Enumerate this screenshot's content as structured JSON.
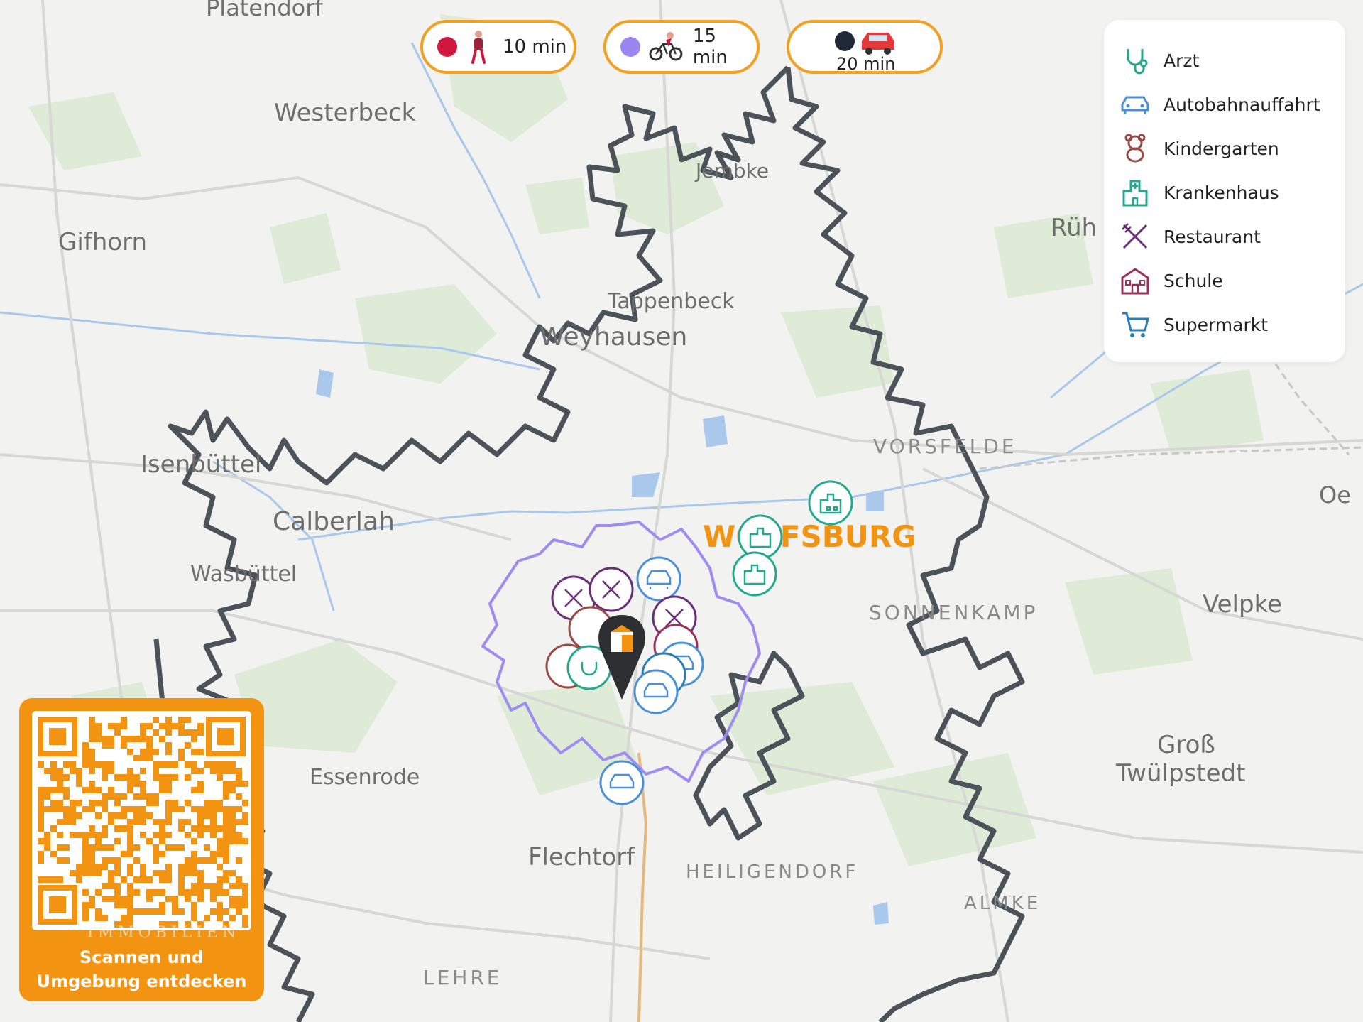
{
  "map": {
    "places": [
      {
        "id": "platendorf",
        "label": "Platendorf"
      },
      {
        "id": "westerbeck",
        "label": "Westerbeck"
      },
      {
        "id": "gifhorn",
        "label": "Gifhorn"
      },
      {
        "id": "jembke",
        "label": "Jembke"
      },
      {
        "id": "ruehen",
        "label": "Rüh"
      },
      {
        "id": "tappenbeck",
        "label": "Tappenbeck"
      },
      {
        "id": "weyhausen",
        "label": "Weyhausen"
      },
      {
        "id": "isenbuettel",
        "label": "Isenbüttel"
      },
      {
        "id": "calberlah",
        "label": "Calberlah"
      },
      {
        "id": "wasbuettel",
        "label": "Wasbüttel"
      },
      {
        "id": "vorsfelde",
        "label": "VORSFELDE"
      },
      {
        "id": "wolfsburg",
        "label": "WOLFSBURG"
      },
      {
        "id": "sonnenkamp",
        "label": "SONNENKAMP"
      },
      {
        "id": "velpke",
        "label": "Velpke"
      },
      {
        "id": "oebisfelde",
        "label": "Oe"
      },
      {
        "id": "gross",
        "label": "Groß"
      },
      {
        "id": "twuelpstedt",
        "label": "Twülpstedt"
      },
      {
        "id": "essenrode",
        "label": "Essenrode"
      },
      {
        "id": "flechtorf",
        "label": "Flechtorf"
      },
      {
        "id": "heiligendorf",
        "label": "HEILIGENDORF"
      },
      {
        "id": "almke",
        "label": "ALMKE"
      },
      {
        "id": "lehre",
        "label": "LEHRE"
      }
    ]
  },
  "travel_modes": [
    {
      "id": "walk",
      "label": "10 min",
      "dot_color": "#d0173f",
      "icon": "walking-person-icon"
    },
    {
      "id": "bike",
      "label": "15 min",
      "dot_color": "#9b86f0",
      "icon": "bicycle-icon"
    },
    {
      "id": "car",
      "label": "20 min",
      "dot_color": "#1f2937",
      "icon": "car-icon"
    }
  ],
  "legend": {
    "items": [
      {
        "id": "arzt",
        "label": "Arzt",
        "icon": "stethoscope-icon",
        "color": "#22a98f"
      },
      {
        "id": "autobahn",
        "label": "Autobahnauffahrt",
        "icon": "car-icon",
        "color": "#4a90d9"
      },
      {
        "id": "kindergarten",
        "label": "Kindergarten",
        "icon": "teddy-bear-icon",
        "color": "#9b4a45"
      },
      {
        "id": "krankenhaus",
        "label": "Krankenhaus",
        "icon": "hospital-icon",
        "color": "#22a98f"
      },
      {
        "id": "restaurant",
        "label": "Restaurant",
        "icon": "fork-knife-icon",
        "color": "#6b2f7a"
      },
      {
        "id": "schule",
        "label": "Schule",
        "icon": "school-icon",
        "color": "#9b2f5a"
      },
      {
        "id": "supermarkt",
        "label": "Supermarkt",
        "icon": "cart-icon",
        "color": "#2a7fb8"
      }
    ]
  },
  "qr_card": {
    "line1": "Scannen und",
    "line2": "Umgebung entdecken",
    "watermark": "IMMOBILIEN",
    "bg_color": "#f39312"
  }
}
